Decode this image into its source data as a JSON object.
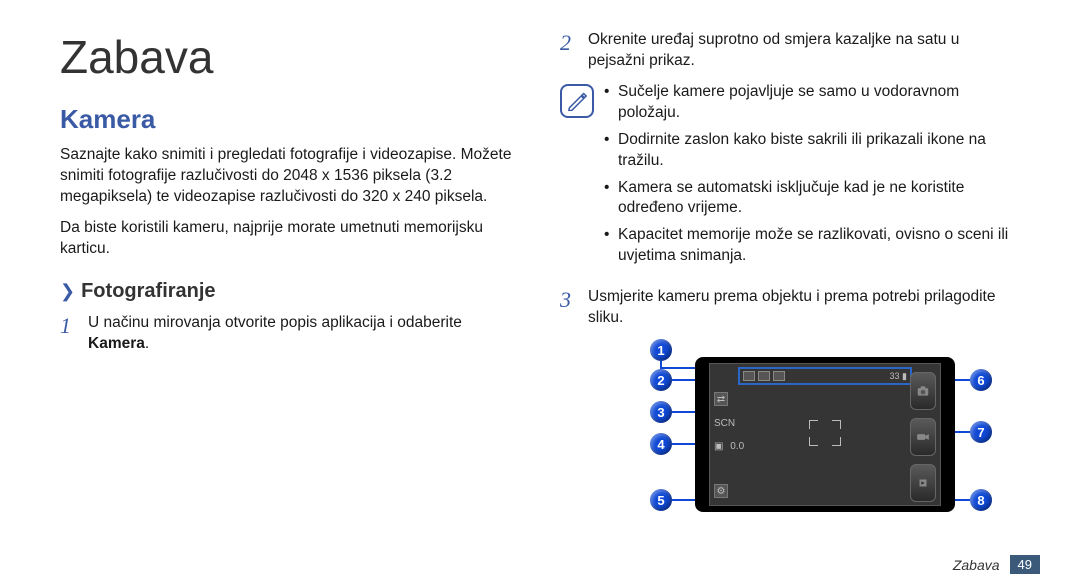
{
  "chapter_title": "Zabava",
  "section_title": "Kamera",
  "intro_p1": "Saznajte kako snimiti i pregledati fotografije i videozapise. Možete snimiti fotografije razlučivosti do 2048 x 1536 piksela (3.2 megapiksela) te videozapise razlučivosti do 320 x 240 piksela.",
  "intro_p2": "Da biste koristili kameru, najprije morate umetnuti memorijsku karticu.",
  "subsection_title": "Fotografiranje",
  "steps": {
    "s1_num": "1",
    "s1_text_a": "U načinu mirovanja otvorite popis aplikacija i odaberite ",
    "s1_text_bold": "Kamera",
    "s1_text_b": ".",
    "s2_num": "2",
    "s2_text": "Okrenite uređaj suprotno od smjera kazaljke na satu u pejsažni prikaz.",
    "s3_num": "3",
    "s3_text": "Usmjerite kameru prema objektu i prema potrebi prilagodite sliku."
  },
  "notes": [
    "Sučelje kamere pojavljuje se samo u vodoravnom položaju.",
    "Dodirnite zaslon kako biste sakrili ili prikazali ikone na tražilu.",
    "Kamera se automatski isključuje kad je ne koristite određeno vrijeme.",
    "Kapacitet memorije može se razlikovati, ovisno o sceni ili uvjetima snimanja."
  ],
  "figure": {
    "scn_label": "SCN",
    "ev_label": "0.0",
    "battery_label": "33",
    "callouts": [
      "1",
      "2",
      "3",
      "4",
      "5",
      "6",
      "7",
      "8"
    ]
  },
  "footer": {
    "label": "Zabava",
    "page": "49"
  }
}
